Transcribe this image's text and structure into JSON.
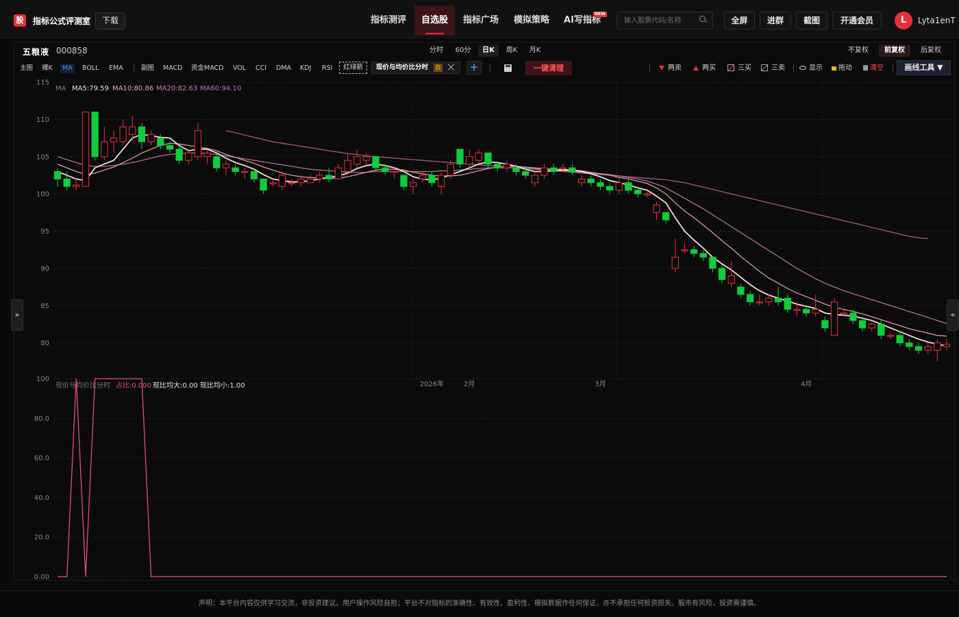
{
  "header": {
    "logo_char": "股",
    "brand": "指标公式评测室",
    "download": "下载",
    "nav": [
      "指标测评",
      "自选股",
      "指标广场",
      "模拟策略",
      "AI写指标"
    ],
    "new_badge": "NEW",
    "search_placeholder": "输入股票代码/名称",
    "buttons": [
      "全屏",
      "进群",
      "截图",
      "开通会员"
    ],
    "avatar_letter": "L",
    "username": "Lyta1enT"
  },
  "stock": {
    "name": "五粮液",
    "code": "000858",
    "periods": [
      "分时",
      "60分",
      "日K",
      "周K",
      "月K"
    ],
    "active_period": "日K",
    "adjust": [
      "不复权",
      "前复权",
      "后复权"
    ],
    "active_adjust": "前复权"
  },
  "indicators": {
    "main": [
      "主图",
      "裸K",
      "MA",
      "BOLL",
      "EMA"
    ],
    "active_main": "MA",
    "sub": [
      "副图",
      "MACD",
      "资金MACD",
      "VOL",
      "CCI",
      "DMA",
      "KDJ",
      "RSI"
    ],
    "redgreen": "红绿箭",
    "formula": "现价与均价比分时",
    "formula_self": "自",
    "clear": "一键清理"
  },
  "tools": {
    "two_sell": "两卖",
    "two_buy": "两买",
    "three_buy": "三买",
    "three_sell": "三卖",
    "show": "显示",
    "drag": "拖动",
    "clear": "清空",
    "draw": "画线工具 ▼"
  },
  "ma_legend": {
    "label": "MA",
    "ma5": "MA5:79.59",
    "ma10": "MA10:80.86",
    "ma20": "MA20:82.63",
    "ma60": "MA60:94.10"
  },
  "sub_legend": {
    "name": "现价与均价比分时",
    "ratio": "占比:0.000",
    "above": "现比均大:0.00",
    "below": "现比均小:1.00"
  },
  "footer": "声明：本平台内容仅供学习交流，非投资建议。用户操作风险自担；平台不对指标的准确性、有效性、盈利性、模拟数据作任何保证，亦不承担任何投资损失。股市有风险，投资需谨慎。",
  "colors": {
    "up": "#e8303a",
    "down": "#11cc3c",
    "ma5": "#f3e0d8",
    "ma10": "#d89aa0",
    "ma20": "#b0708c",
    "ma60": "#a05a8a",
    "sub": "#e0507a"
  },
  "chart_data": [
    {
      "type": "candlestick",
      "y_ticks": [
        115,
        110,
        105,
        100,
        95,
        90,
        85,
        80
      ],
      "ylim": [
        75,
        115
      ],
      "x_labels": [
        "2026年",
        "2月",
        "3月",
        "4月"
      ],
      "x_label_index": [
        40,
        44,
        58,
        80
      ],
      "candles": [
        [
          103.0,
          102.0,
          103.5,
          101.0
        ],
        [
          102.0,
          101.0,
          103.0,
          100.5
        ],
        [
          101.0,
          101.2,
          102.0,
          100.5
        ],
        [
          101.0,
          111.0,
          111.0,
          101.0
        ],
        [
          111.0,
          105.0,
          111.0,
          104.5
        ],
        [
          105.0,
          107.0,
          109.0,
          104.5
        ],
        [
          107.0,
          107.5,
          108.5,
          105.5
        ],
        [
          107.0,
          109.0,
          110.0,
          106.5
        ],
        [
          108.0,
          109.0,
          110.5,
          107.0
        ],
        [
          109.0,
          107.0,
          109.5,
          106.0
        ],
        [
          107.0,
          108.0,
          108.5,
          106.5
        ],
        [
          107.5,
          106.5,
          108.0,
          106.0
        ],
        [
          106.5,
          106.0,
          107.0,
          105.5
        ],
        [
          106.0,
          104.5,
          106.5,
          104.0
        ],
        [
          104.5,
          105.5,
          106.0,
          104.0
        ],
        [
          105.0,
          108.5,
          109.5,
          104.5
        ],
        [
          105.0,
          105.5,
          106.0,
          104.0
        ],
        [
          105.0,
          103.5,
          105.5,
          103.0
        ],
        [
          103.5,
          104.0,
          104.5,
          102.5
        ],
        [
          103.5,
          103.0,
          104.0,
          102.5
        ],
        [
          103.0,
          103.0,
          103.5,
          102.0
        ],
        [
          103.0,
          102.0,
          103.5,
          101.5
        ],
        [
          102.0,
          100.5,
          102.0,
          100.0
        ],
        [
          101.5,
          101.5,
          102.0,
          101.0
        ],
        [
          101.0,
          102.5,
          103.0,
          100.5
        ],
        [
          101.5,
          101.5,
          102.0,
          101.0
        ],
        [
          101.5,
          102.0,
          102.5,
          101.0
        ],
        [
          101.5,
          102.0,
          102.5,
          101.5
        ],
        [
          102.0,
          102.5,
          103.0,
          101.5
        ],
        [
          102.5,
          102.0,
          103.5,
          101.5
        ],
        [
          102.0,
          103.5,
          104.0,
          102.0
        ],
        [
          103.0,
          104.5,
          105.5,
          102.5
        ],
        [
          104.0,
          105.0,
          106.0,
          103.5
        ],
        [
          104.5,
          105.0,
          105.5,
          104.0
        ],
        [
          105.0,
          103.5,
          105.0,
          103.0
        ],
        [
          103.5,
          103.0,
          104.0,
          102.5
        ],
        [
          103.0,
          103.0,
          103.5,
          102.0
        ],
        [
          102.5,
          101.0,
          102.5,
          100.5
        ],
        [
          101.0,
          101.5,
          102.0,
          100.0
        ],
        [
          102.0,
          102.5,
          103.0,
          101.5
        ],
        [
          102.5,
          101.5,
          103.0,
          101.0
        ],
        [
          101.0,
          102.5,
          103.0,
          100.0
        ],
        [
          102.5,
          104.0,
          104.5,
          102.0
        ],
        [
          106.0,
          104.0,
          106.0,
          103.5
        ],
        [
          104.0,
          105.0,
          106.0,
          103.5
        ],
        [
          104.5,
          105.5,
          106.0,
          104.0
        ],
        [
          105.5,
          104.0,
          105.5,
          103.5
        ],
        [
          104.0,
          103.5,
          104.0,
          103.0
        ],
        [
          103.5,
          104.0,
          104.5,
          103.0
        ],
        [
          103.5,
          103.0,
          104.0,
          102.5
        ],
        [
          103.0,
          102.5,
          103.5,
          102.0
        ],
        [
          101.5,
          102.5,
          103.0,
          101.0
        ],
        [
          102.5,
          103.5,
          104.0,
          102.0
        ],
        [
          103.5,
          103.0,
          104.0,
          102.5
        ],
        [
          103.5,
          103.5,
          104.0,
          103.0
        ],
        [
          103.5,
          103.0,
          104.0,
          102.5
        ],
        [
          101.5,
          102.0,
          102.5,
          101.0
        ],
        [
          102.0,
          101.5,
          102.5,
          101.0
        ],
        [
          101.5,
          101.0,
          102.0,
          100.5
        ],
        [
          101.0,
          100.5,
          101.5,
          100.0
        ],
        [
          100.5,
          101.5,
          102.0,
          100.0
        ],
        [
          101.5,
          100.5,
          102.0,
          100.0
        ],
        [
          100.5,
          100.0,
          101.0,
          99.5
        ],
        [
          100.0,
          100.0,
          100.5,
          99.5
        ],
        [
          97.5,
          98.5,
          99.0,
          96.5
        ],
        [
          97.5,
          96.5,
          97.5,
          96.0
        ],
        [
          90.0,
          91.5,
          94.0,
          89.5
        ],
        [
          92.5,
          92.5,
          93.5,
          92.0
        ],
        [
          92.5,
          92.0,
          93.0,
          91.5
        ],
        [
          92.0,
          91.5,
          92.5,
          91.0
        ],
        [
          91.5,
          90.0,
          91.5,
          89.5
        ],
        [
          90.0,
          88.5,
          90.5,
          88.0
        ],
        [
          88.0,
          89.0,
          91.0,
          87.5
        ],
        [
          87.5,
          86.5,
          88.0,
          86.0
        ],
        [
          86.5,
          85.5,
          87.0,
          85.0
        ],
        [
          85.5,
          85.5,
          86.5,
          85.0
        ],
        [
          85.5,
          86.0,
          86.5,
          85.0
        ],
        [
          86.0,
          85.5,
          87.5,
          85.0
        ],
        [
          86.0,
          84.5,
          86.5,
          84.0
        ],
        [
          84.5,
          84.5,
          85.5,
          83.5
        ],
        [
          84.5,
          84.0,
          85.0,
          83.5
        ],
        [
          84.0,
          84.5,
          86.5,
          83.5
        ],
        [
          83.0,
          82.0,
          83.5,
          81.5
        ],
        [
          81.0,
          85.5,
          86.0,
          81.0
        ],
        [
          84.0,
          84.0,
          84.5,
          83.5
        ],
        [
          84.0,
          83.0,
          84.5,
          82.5
        ],
        [
          83.0,
          82.0,
          83.5,
          81.5
        ],
        [
          82.0,
          82.5,
          83.0,
          81.5
        ],
        [
          82.5,
          81.0,
          83.0,
          80.5
        ],
        [
          81.0,
          81.0,
          81.5,
          80.5
        ],
        [
          81.0,
          80.0,
          81.5,
          79.5
        ],
        [
          80.0,
          79.5,
          80.5,
          79.0
        ],
        [
          79.5,
          79.0,
          80.0,
          78.5
        ],
        [
          79.0,
          79.5,
          80.0,
          78.5
        ],
        [
          79.0,
          80.0,
          80.5,
          77.5
        ],
        [
          79.5,
          79.8,
          80.5,
          79.0
        ]
      ],
      "ma5": [
        103.0,
        102.5,
        102.0,
        101.8,
        103.5,
        104.0,
        104.5,
        106.0,
        107.5,
        108.0,
        107.8,
        107.6,
        107.5,
        106.5,
        105.8,
        106.0,
        106.0,
        105.5,
        104.8,
        104.2,
        103.8,
        103.3,
        102.6,
        102.0,
        101.8,
        101.6,
        101.6,
        101.8,
        102.0,
        102.2,
        102.4,
        102.8,
        103.4,
        103.8,
        104.0,
        103.8,
        103.5,
        103.0,
        102.3,
        102.0,
        101.9,
        102.1,
        102.6,
        103.0,
        103.5,
        104.0,
        104.3,
        104.2,
        104.0,
        103.7,
        103.3,
        103.0,
        103.0,
        103.1,
        103.2,
        103.2,
        103.0,
        102.7,
        102.3,
        101.8,
        101.5,
        101.2,
        100.8,
        100.5,
        99.7,
        98.8,
        96.8,
        95.0,
        93.8,
        92.7,
        91.5,
        90.6,
        89.8,
        88.8,
        87.8,
        87.0,
        86.4,
        86.0,
        85.6,
        85.2,
        84.9,
        84.6,
        84.0,
        83.8,
        83.7,
        83.6,
        83.3,
        83.0,
        82.5,
        82.0,
        81.5,
        81.0,
        80.5,
        80.1,
        79.8,
        79.6
      ],
      "ma10": [
        104.0,
        103.5,
        103.0,
        102.6,
        102.8,
        103.2,
        103.6,
        104.2,
        104.8,
        105.5,
        106.0,
        106.5,
        106.8,
        106.7,
        106.5,
        106.3,
        106.1,
        105.8,
        105.3,
        104.9,
        104.5,
        104.1,
        103.6,
        103.2,
        102.8,
        102.5,
        102.3,
        102.2,
        102.1,
        102.1,
        102.1,
        102.3,
        102.6,
        102.9,
        103.2,
        103.3,
        103.3,
        103.2,
        102.9,
        102.7,
        102.5,
        102.4,
        102.4,
        102.5,
        102.8,
        103.1,
        103.4,
        103.6,
        103.7,
        103.7,
        103.6,
        103.5,
        103.4,
        103.3,
        103.3,
        103.2,
        103.1,
        102.9,
        102.7,
        102.5,
        102.2,
        102.0,
        101.7,
        101.4,
        100.8,
        100.0,
        98.8,
        97.7,
        96.8,
        95.8,
        94.8,
        93.7,
        92.7,
        91.6,
        90.6,
        89.6,
        88.7,
        88.0,
        87.3,
        86.7,
        86.2,
        85.7,
        85.2,
        84.8,
        84.5,
        84.2,
        83.9,
        83.5,
        83.1,
        82.7,
        82.3,
        81.9,
        81.6,
        81.3,
        81.0,
        80.9
      ],
      "ma20": [
        105.0,
        104.6,
        104.2,
        103.8,
        103.7,
        103.7,
        103.8,
        104.0,
        104.2,
        104.5,
        104.8,
        105.1,
        105.3,
        105.4,
        105.5,
        105.5,
        105.4,
        105.3,
        105.1,
        104.9,
        104.7,
        104.5,
        104.3,
        104.1,
        103.9,
        103.7,
        103.5,
        103.3,
        103.2,
        103.1,
        103.0,
        102.9,
        102.9,
        102.9,
        103.0,
        103.0,
        103.0,
        103.0,
        103.0,
        103.0,
        103.0,
        103.1,
        103.1,
        103.2,
        103.3,
        103.4,
        103.5,
        103.5,
        103.5,
        103.5,
        103.5,
        103.4,
        103.3,
        103.2,
        103.1,
        103.0,
        102.9,
        102.8,
        102.7,
        102.6,
        102.4,
        102.2,
        102.0,
        101.7,
        101.3,
        100.8,
        100.1,
        99.4,
        98.7,
        98.0,
        97.2,
        96.4,
        95.6,
        94.8,
        94.0,
        93.2,
        92.4,
        91.6,
        90.8,
        90.0,
        89.3,
        88.6,
        88.0,
        87.5,
        87.0,
        86.6,
        86.2,
        85.8,
        85.4,
        85.0,
        84.6,
        84.2,
        83.8,
        83.4,
        83.0,
        82.6
      ],
      "ma60": [
        null,
        null,
        null,
        null,
        null,
        null,
        null,
        null,
        null,
        null,
        null,
        null,
        null,
        null,
        null,
        null,
        null,
        null,
        108.5,
        108.2,
        107.9,
        107.6,
        107.3,
        107.0,
        106.8,
        106.6,
        106.4,
        106.2,
        106.0,
        105.8,
        105.6,
        105.4,
        105.3,
        105.1,
        105.0,
        104.9,
        104.8,
        104.7,
        104.6,
        104.5,
        104.4,
        104.3,
        104.2,
        104.1,
        104.0,
        103.9,
        103.8,
        103.7,
        103.6,
        103.5,
        103.4,
        103.3,
        103.2,
        103.1,
        103.0,
        102.9,
        102.8,
        102.7,
        102.6,
        102.5,
        102.4,
        102.3,
        102.2,
        102.1,
        102.0,
        101.9,
        101.7,
        101.5,
        101.2,
        100.9,
        100.6,
        100.3,
        100.0,
        99.7,
        99.4,
        99.1,
        98.8,
        98.5,
        98.2,
        97.9,
        97.6,
        97.3,
        97.0,
        96.7,
        96.4,
        96.1,
        95.8,
        95.5,
        95.2,
        94.9,
        94.6,
        94.3,
        94.1,
        94.0
      ]
    },
    {
      "type": "line",
      "title": "现价与均价比分时",
      "y_ticks": [
        "100",
        "80.0",
        "60.0",
        "40.0",
        "20.0",
        "0.00"
      ],
      "ylim": [
        0,
        100
      ],
      "series": [
        {
          "name": "占比",
          "values": [
            0,
            0,
            100,
            0,
            100,
            100,
            100,
            100,
            100,
            100,
            0,
            0,
            0,
            0,
            0,
            0,
            0,
            0,
            0,
            0,
            0,
            0,
            0,
            0,
            0,
            0,
            0,
            0,
            0,
            0,
            0,
            0,
            0,
            0,
            0,
            0,
            0,
            0,
            0,
            0,
            0,
            0,
            0,
            0,
            0,
            0,
            0,
            0,
            0,
            0,
            0,
            0,
            0,
            0,
            0,
            0,
            0,
            0,
            0,
            0,
            0,
            0,
            0,
            0,
            0,
            0,
            0,
            0,
            0,
            0,
            0,
            0,
            0,
            0,
            0,
            0,
            0,
            0,
            0,
            0,
            0,
            0,
            0,
            0,
            0,
            0,
            0,
            0,
            0,
            0,
            0,
            0,
            0,
            0,
            0,
            0
          ]
        }
      ]
    }
  ]
}
